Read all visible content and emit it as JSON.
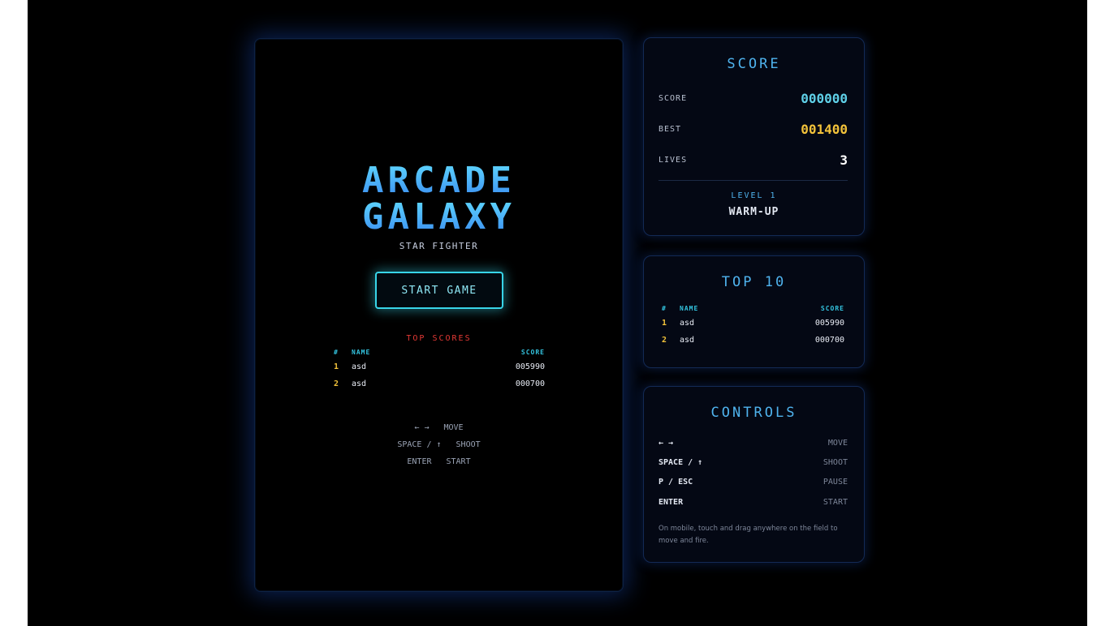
{
  "game": {
    "title_line1": "ARCADE",
    "title_line2": "GALAXY",
    "subtitle": "STAR FIGHTER",
    "start_label": "START GAME",
    "top_scores_title": "TOP SCORES",
    "table_headers": {
      "rank": "#",
      "name": "NAME",
      "score": "SCORE"
    },
    "scores": [
      {
        "rank": "1",
        "name": "asd",
        "score": "005990"
      },
      {
        "rank": "2",
        "name": "asd",
        "score": "000700"
      }
    ],
    "controls": [
      {
        "key": "← →",
        "action": "MOVE"
      },
      {
        "key": "SPACE / ↑",
        "action": "SHOOT"
      },
      {
        "key": "ENTER",
        "action": "START"
      }
    ]
  },
  "score_panel": {
    "title": "SCORE",
    "score_label": "SCORE",
    "score_value": "000000",
    "best_label": "BEST",
    "best_value": "001400",
    "lives_label": "LIVES",
    "lives_value": "3",
    "level_label": "LEVEL 1",
    "level_name": "WARM-UP"
  },
  "top_panel": {
    "title": "TOP 10",
    "headers": {
      "rank": "#",
      "name": "NAME",
      "score": "SCORE"
    },
    "scores": [
      {
        "rank": "1",
        "name": "asd",
        "score": "005990"
      },
      {
        "rank": "2",
        "name": "asd",
        "score": "000700"
      }
    ]
  },
  "controls_panel": {
    "title": "CONTROLS",
    "items": [
      {
        "key": "← →",
        "action": "MOVE"
      },
      {
        "key": "SPACE / ↑",
        "action": "SHOOT"
      },
      {
        "key": "P / ESC",
        "action": "PAUSE"
      },
      {
        "key": "ENTER",
        "action": "START"
      }
    ],
    "note": "On mobile, touch and drag anywhere on the field to move and fire."
  },
  "colors": {
    "accent_cyan": "#38d5e8",
    "title_blue": "#4fb3ee",
    "gold": "#f2c23a",
    "red": "#e53935"
  }
}
